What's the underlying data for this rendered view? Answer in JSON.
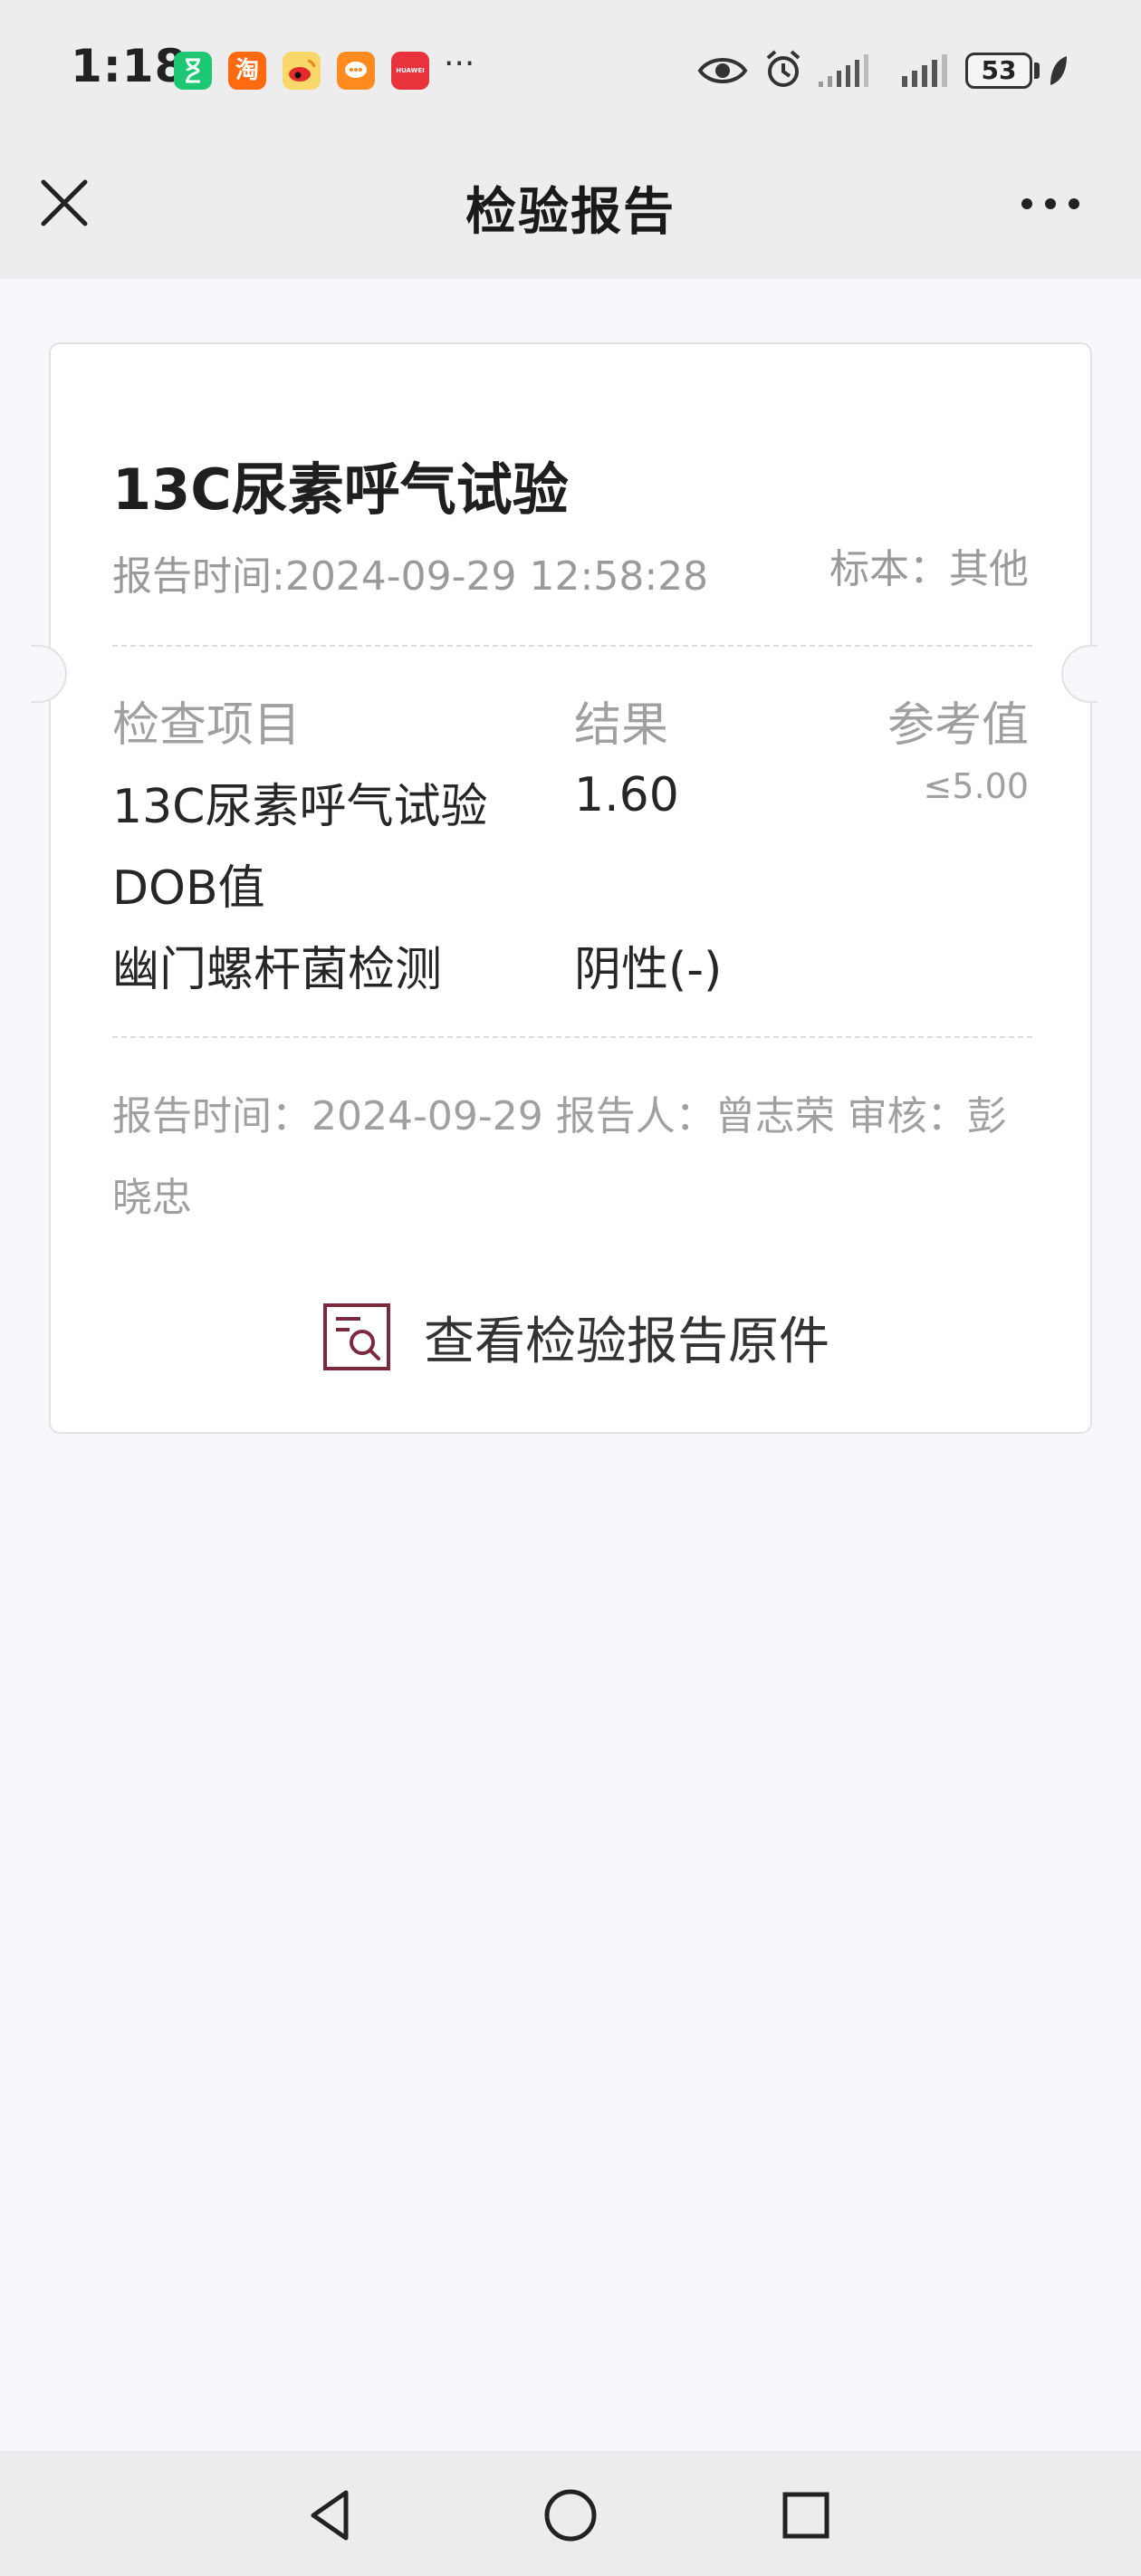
{
  "status_bar": {
    "time": "1:18",
    "app_icons": [
      {
        "name": "hourglass-app-icon",
        "glyph": "⌛",
        "color": "#1ec774"
      },
      {
        "name": "taobao-app-icon",
        "glyph": "淘",
        "color": "#ff6a10"
      },
      {
        "name": "weibo-app-icon",
        "glyph": "◉",
        "color": "#f5c54a"
      },
      {
        "name": "chat-app-icon",
        "glyph": "◍",
        "color": "#ff8a1f"
      },
      {
        "name": "huawei-app-icon",
        "glyph": "HUAWEI",
        "color": "#e8323c"
      }
    ],
    "more": "···",
    "battery": "53"
  },
  "header": {
    "title": "检验报告"
  },
  "report": {
    "title": "13C尿素呼气试验",
    "report_time": "报告时间:2024-09-29 12:58:28",
    "specimen": "标本：其他",
    "columns": {
      "item": "检查项目",
      "result": "结果",
      "reference": "参考值"
    },
    "rows": [
      {
        "item": "13C尿素呼气试验",
        "result": "1.60",
        "reference": "≤5.00"
      },
      {
        "item": "DOB值",
        "result": "",
        "reference": ""
      },
      {
        "item": "幽门螺杆菌检测",
        "result": "阴性(-)",
        "reference": ""
      }
    ],
    "footer": "报告时间：2024-09-29 报告人：曾志荣 审核：彭晓忠",
    "view_original_label": "查看检验报告原件"
  }
}
